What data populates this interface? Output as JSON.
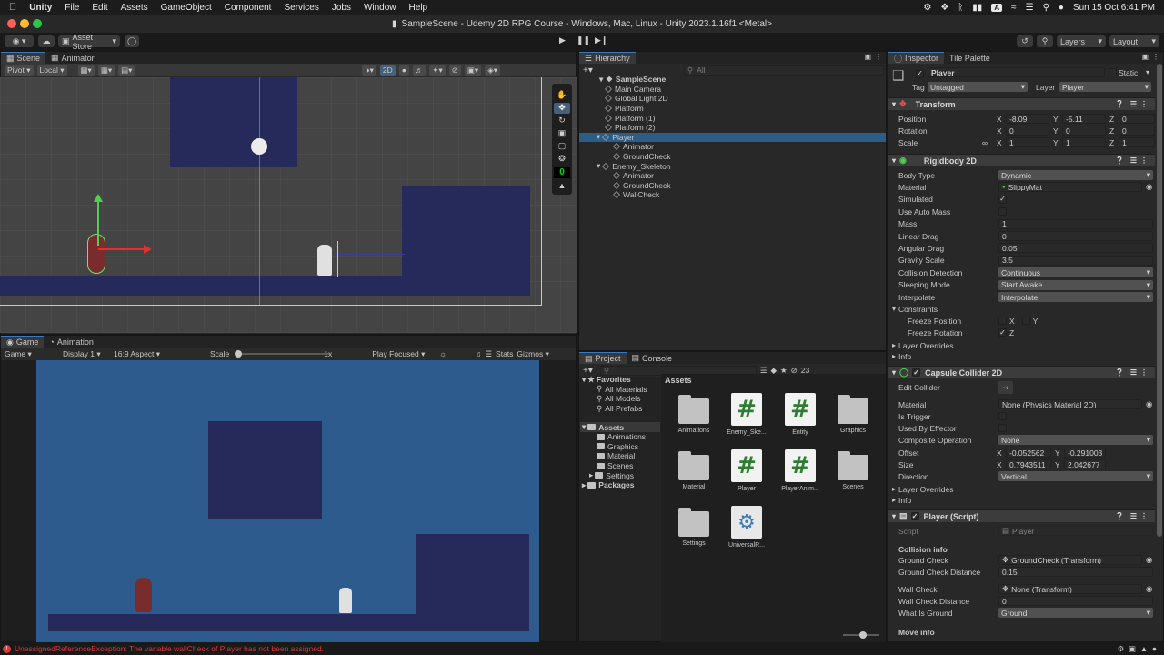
{
  "menubar": {
    "app": "Unity",
    "items": [
      "File",
      "Edit",
      "Assets",
      "GameObject",
      "Component",
      "Services",
      "Jobs",
      "Window",
      "Help"
    ],
    "clock": "Sun 15 Oct  6:41 PM",
    "input_badge": "A"
  },
  "window": {
    "title": "SampleScene - Udemy 2D RPG Course - Windows, Mac, Linux - Unity 2023.1.16f1 <Metal>"
  },
  "toolbar": {
    "asset_store": "Asset Store",
    "layers": "Layers",
    "layout": "Layout"
  },
  "scene_panel": {
    "tabs": [
      "Scene",
      "Animator"
    ],
    "pivot": "Pivot",
    "local": "Local",
    "mode_2d": "2D",
    "overlay_counter": "0"
  },
  "game_panel": {
    "tabs": [
      "Game",
      "Animation"
    ],
    "game_dropdown": "Game",
    "display": "Display 1",
    "aspect": "16:9 Aspect",
    "scale_label": "Scale",
    "scale_value": "1x",
    "scale_fraction": 0.0,
    "play_focused": "Play Focused",
    "stats": "Stats",
    "gizmos": "Gizmos"
  },
  "hierarchy": {
    "tab": "Hierarchy",
    "search_placeholder": "All",
    "scene": "SampleScene",
    "items": [
      {
        "label": "Main Camera",
        "depth": 1
      },
      {
        "label": "Global Light 2D",
        "depth": 1
      },
      {
        "label": "Platform",
        "depth": 1
      },
      {
        "label": "Platform (1)",
        "depth": 1
      },
      {
        "label": "Platform (2)",
        "depth": 1
      },
      {
        "label": "Player",
        "depth": 1,
        "selected": true
      },
      {
        "label": "Animator",
        "depth": 2
      },
      {
        "label": "GroundCheck",
        "depth": 2
      },
      {
        "label": "Enemy_Skeleton",
        "depth": 1
      },
      {
        "label": "Animator",
        "depth": 2
      },
      {
        "label": "GroundCheck",
        "depth": 2
      },
      {
        "label": "WallCheck",
        "depth": 2
      }
    ]
  },
  "project": {
    "tabs": [
      "Project",
      "Console"
    ],
    "count": "23",
    "favorites": "Favorites",
    "fav_items": [
      "All Materials",
      "All Models",
      "All Prefabs"
    ],
    "assets_root": "Assets",
    "asset_folders": [
      "Animations",
      "Graphics",
      "Material",
      "Scenes",
      "Settings"
    ],
    "packages": "Packages",
    "header": "Assets",
    "grid": [
      {
        "label": "Animations",
        "kind": "folder"
      },
      {
        "label": "Enemy_Ske...",
        "kind": "script"
      },
      {
        "label": "Entity",
        "kind": "script"
      },
      {
        "label": "Graphics",
        "kind": "folder"
      },
      {
        "label": "Material",
        "kind": "folder"
      },
      {
        "label": "Player",
        "kind": "script"
      },
      {
        "label": "PlayerAnim...",
        "kind": "script"
      },
      {
        "label": "Scenes",
        "kind": "folder"
      },
      {
        "label": "Settings",
        "kind": "folder"
      },
      {
        "label": "UniversalR...",
        "kind": "settings"
      }
    ]
  },
  "inspector": {
    "tabs": [
      "Inspector",
      "Tile Palette"
    ],
    "object_name": "Player",
    "static_label": "Static",
    "tag_label": "Tag",
    "tag_value": "Untagged",
    "layer_label": "Layer",
    "layer_value": "Player",
    "transform": {
      "title": "Transform",
      "position_label": "Position",
      "pos_x": "-8.09",
      "pos_y": "-5.11",
      "pos_z": "0",
      "rotation_label": "Rotation",
      "rot_x": "0",
      "rot_y": "0",
      "rot_z": "0",
      "scale_label": "Scale",
      "scl_x": "1",
      "scl_y": "1",
      "scl_z": "1"
    },
    "rigidbody": {
      "title": "Rigidbody 2D",
      "rows": [
        {
          "label": "Body Type",
          "value": "Dynamic",
          "kind": "drop"
        },
        {
          "label": "Material",
          "value": "SlippyMat",
          "kind": "obj"
        },
        {
          "label": "Simulated",
          "value": "✓",
          "kind": "check"
        },
        {
          "label": "Use Auto Mass",
          "value": "",
          "kind": "check"
        },
        {
          "label": "Mass",
          "value": "1",
          "kind": "field"
        },
        {
          "label": "Linear Drag",
          "value": "0",
          "kind": "field"
        },
        {
          "label": "Angular Drag",
          "value": "0.05",
          "kind": "field"
        },
        {
          "label": "Gravity Scale",
          "value": "3.5",
          "kind": "field"
        },
        {
          "label": "Collision Detection",
          "value": "Continuous",
          "kind": "drop"
        },
        {
          "label": "Sleeping Mode",
          "value": "Start Awake",
          "kind": "drop"
        },
        {
          "label": "Interpolate",
          "value": "Interpolate",
          "kind": "drop"
        }
      ],
      "constraints": "Constraints",
      "freeze_position": "Freeze Position",
      "freeze_rotation": "Freeze Rotation",
      "x": "X",
      "y": "Y",
      "z": "Z",
      "layer_overrides": "Layer Overrides",
      "info": "Info"
    },
    "capsule": {
      "title": "Capsule Collider 2D",
      "edit_collider": "Edit Collider",
      "material_label": "Material",
      "material_value": "None (Physics Material 2D)",
      "is_trigger": "Is Trigger",
      "used_by_effector": "Used By Effector",
      "composite_label": "Composite Operation",
      "composite_value": "None",
      "offset_label": "Offset",
      "off_x": "-0.052562",
      "off_y": "-0.291003",
      "size_label": "Size",
      "size_x": "0.7943511",
      "size_y": "2.042677",
      "direction_label": "Direction",
      "direction_value": "Vertical",
      "layer_overrides": "Layer Overrides",
      "info": "Info"
    },
    "player_script": {
      "title": "Player (Script)",
      "script_label": "Script",
      "script_value": "Player",
      "section": "Collision info",
      "ground_check_label": "Ground Check",
      "ground_check_value": "GroundCheck (Transform)",
      "ground_dist_label": "Ground Check Distance",
      "ground_dist_value": "0.15",
      "wall_check_label": "Wall Check",
      "wall_check_value": "None (Transform)",
      "wall_dist_label": "Wall Check Distance",
      "wall_dist_value": "0",
      "what_ground_label": "What Is Ground",
      "what_ground_value": "Ground",
      "move_info": "Move info"
    }
  },
  "status": {
    "message": "UnassignedReferenceException: The variable wallCheck of Player has not been assigned."
  },
  "colors": {
    "accent": "#3a79bb",
    "selection": "#2c5d87",
    "error": "#d8383a",
    "game_bg": "#2e5b8e",
    "platform": "#262a5a"
  }
}
